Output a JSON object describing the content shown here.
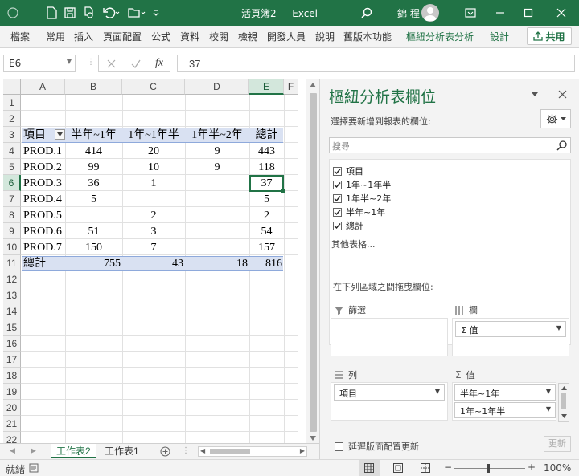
{
  "titlebar": {
    "title": "活頁簿2  -  Excel",
    "user": "錦 程",
    "bg_color": "#217346"
  },
  "ribbon": {
    "tabs": [
      "檔案",
      "常用",
      "插入",
      "頁面配置",
      "公式",
      "資料",
      "校閱",
      "檢視",
      "開發人員",
      "說明",
      "舊版本功能",
      "樞紐分析表分析",
      "設計"
    ],
    "share": "共用"
  },
  "formula_bar": {
    "name_box": "E6",
    "fx": "fx",
    "value": "37"
  },
  "sheet": {
    "columns": [
      "A",
      "B",
      "C",
      "D",
      "E",
      "F"
    ],
    "rows": [
      "1",
      "2",
      "3",
      "4",
      "5",
      "6",
      "7",
      "8",
      "9",
      "10",
      "11",
      "12",
      "13",
      "14",
      "15",
      "16",
      "17",
      "18",
      "19",
      "20",
      "21",
      "22"
    ],
    "header": {
      "a": "項目",
      "b": "半年~1年",
      "c": "1年~1年半",
      "d": "1年半~2年",
      "e": "總計"
    },
    "data": [
      {
        "a": "PROD.1",
        "b": "414",
        "c": "20",
        "d": "9",
        "e": "443"
      },
      {
        "a": "PROD.2",
        "b": "99",
        "c": "10",
        "d": "9",
        "e": "118"
      },
      {
        "a": "PROD.3",
        "b": "36",
        "c": "1",
        "d": "",
        "e": "37"
      },
      {
        "a": "PROD.4",
        "b": "5",
        "c": "",
        "d": "",
        "e": "5"
      },
      {
        "a": "PROD.5",
        "b": "",
        "c": "2",
        "d": "",
        "e": "2"
      },
      {
        "a": "PROD.6",
        "b": "51",
        "c": "3",
        "d": "",
        "e": "54"
      },
      {
        "a": "PROD.7",
        "b": "150",
        "c": "7",
        "d": "",
        "e": "157"
      }
    ],
    "total": {
      "a": "總計",
      "b": "755",
      "c": "43",
      "d": "18",
      "e": "816"
    },
    "band_color": "#d9e1f2"
  },
  "sheet_tabs": [
    "工作表2",
    "工作表1"
  ],
  "status": {
    "ready": "就緒",
    "zoom": "100%"
  },
  "pivot_pane": {
    "title": "樞紐分析表欄位",
    "choose_label": "選擇要新增到報表的欄位:",
    "search_placeholder": "搜尋",
    "fields": [
      "項目",
      "1年~1年半",
      "1年半~2年",
      "半年~1年",
      "總計"
    ],
    "more_tables": "其他表格...",
    "drag_label": "在下列區域之間拖曳欄位:",
    "filters_label": "篩選",
    "columns_label": "欄",
    "rows_label": "列",
    "values_label": "值",
    "columns_chip": "Σ 值",
    "rows_chip": "項目",
    "values_chips": [
      "半年~1年",
      "1年~1年半"
    ],
    "defer_label": "延遲版面配置更新",
    "update_button": "更新"
  }
}
